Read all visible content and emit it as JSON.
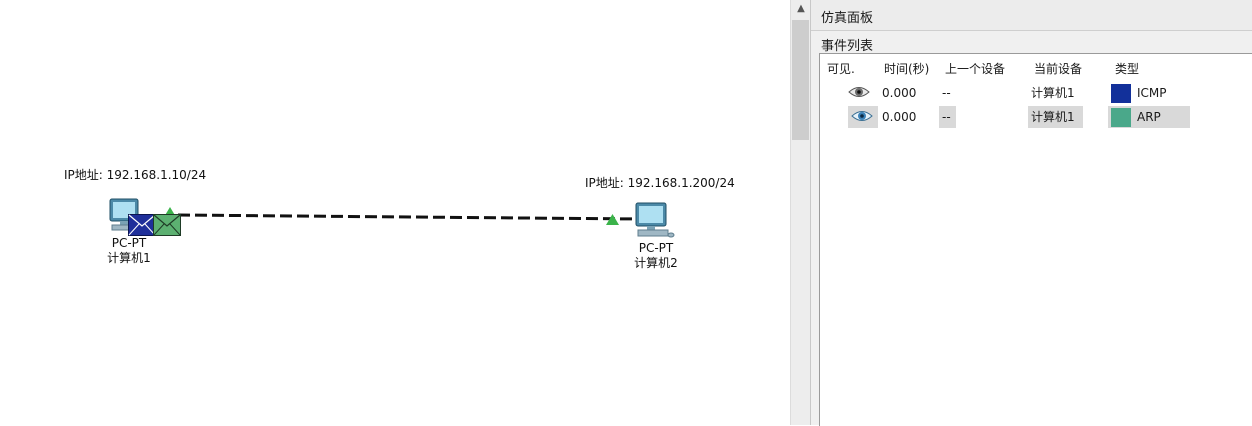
{
  "workspace": {
    "pc1": {
      "ip_text": "IP地址: 192.168.1.10/24",
      "model": "PC-PT",
      "name": "计算机1"
    },
    "pc2": {
      "ip_text": "IP地址: 192.168.1.200/24",
      "model": "PC-PT",
      "name": "计算机2"
    },
    "envelope_colors": {
      "icmp": "#1f2f9a",
      "arp": "#4fa86b"
    },
    "link_status_color": "#3bb34a"
  },
  "scrollbar": {
    "arrow": "▲"
  },
  "simulation_panel": {
    "title": "仿真面板",
    "event_list": {
      "title": "事件列表",
      "columns": [
        "可见.",
        "时间(秒)",
        "上一个设备",
        "当前设备",
        "类型"
      ],
      "rows": [
        {
          "visible_icon": "eye-icon",
          "time": "0.000",
          "last_device": "--",
          "at_device": "计算机1",
          "type": "ICMP",
          "type_color": "#12309a"
        },
        {
          "visible_icon": "eye-icon",
          "time": "0.000",
          "last_device": "--",
          "at_device": "计算机1",
          "type": "ARP",
          "type_color": "#4aa88a"
        }
      ]
    }
  }
}
